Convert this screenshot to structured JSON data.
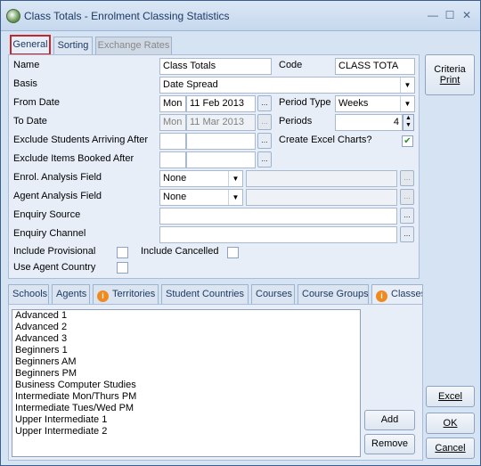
{
  "window": {
    "title": "Class Totals - Enrolment Classing Statistics"
  },
  "tabs": [
    "General",
    "Sorting",
    "Exchange Rates"
  ],
  "form": {
    "name_label": "Name",
    "name_value": "Class Totals",
    "code_label": "Code",
    "code_value": "CLASS TOTA",
    "basis_label": "Basis",
    "basis_value": "Date Spread",
    "from_date_label": "From Date",
    "from_day": "Mon",
    "from_date": "11 Feb 2013",
    "period_type_label": "Period Type",
    "period_type_value": "Weeks",
    "to_date_label": "To Date",
    "to_day": "Mon",
    "to_date": "11 Mar 2013",
    "periods_label": "Periods",
    "periods_value": "4",
    "exclude_arriving_label": "Exclude Students Arriving After",
    "create_excel_label": "Create Excel Charts?",
    "create_excel_checked": "✔",
    "exclude_items_label": "Exclude Items Booked After",
    "enrol_field_label": "Enrol. Analysis Field",
    "enrol_field_value": "None",
    "agent_field_label": "Agent Analysis Field",
    "agent_field_value": "None",
    "enquiry_source_label": "Enquiry Source",
    "enquiry_channel_label": "Enquiry Channel",
    "include_provisional_label": "Include Provisional",
    "include_cancelled_label": "Include Cancelled",
    "use_agent_country_label": "Use Agent Country",
    "ellipsis": "..."
  },
  "bottom_tabs": [
    "Schools",
    "Agents",
    "Territories",
    "Student Countries",
    "Courses",
    "Course Groups",
    "Classes"
  ],
  "classes": [
    "Advanced 1",
    "Advanced 2",
    "Advanced 3",
    "Beginners 1",
    "Beginners AM",
    "Beginners PM",
    "Business Computer Studies",
    "Intermediate Mon/Thurs PM",
    "Intermediate Tues/Wed PM",
    "Upper Intermediate 1",
    "Upper Intermediate 2"
  ],
  "buttons": {
    "criteria_line1": "Criteria",
    "criteria_line2": "Print",
    "add": "Add",
    "remove": "Remove",
    "excel": "Excel",
    "ok": "OK",
    "cancel": "Cancel"
  },
  "colors": {
    "accent_border": "#c0282d",
    "window_bg": "#d6e3f3",
    "check_color": "#2b8a2b",
    "info_icon": "#f08a1e"
  }
}
